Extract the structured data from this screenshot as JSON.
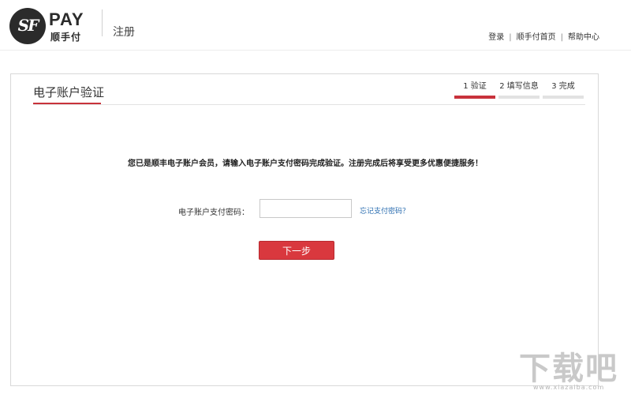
{
  "header": {
    "logo": {
      "mark": "SF",
      "wordmark": "PAY",
      "name_cn": "顺手付"
    },
    "page_mode": "注册",
    "links": [
      {
        "label": "登录"
      },
      {
        "label": "顺手付首页"
      },
      {
        "label": "帮助中心"
      }
    ],
    "link_separator": "|"
  },
  "card": {
    "title": "电子账户验证",
    "steps": [
      {
        "label": "1 验证",
        "active": true
      },
      {
        "label": "2 填写信息",
        "active": false
      },
      {
        "label": "3 完成",
        "active": false
      }
    ],
    "notice": "您已是顺丰电子账户会员，请输入电子账户支付密码完成验证。注册完成后将享受更多优惠便捷服务！",
    "password_field": {
      "label": "电子账户支付密码：",
      "value": "",
      "placeholder": ""
    },
    "forgot_link": "忘记支付密码？",
    "next_button": "下一步"
  },
  "watermark": {
    "text": "下载吧",
    "url": "www.xiazaiba.com"
  },
  "colors": {
    "accent": "#c8323b",
    "button": "#d9383e",
    "link": "#2a6db0",
    "step_inactive": "#e2e2e2"
  }
}
